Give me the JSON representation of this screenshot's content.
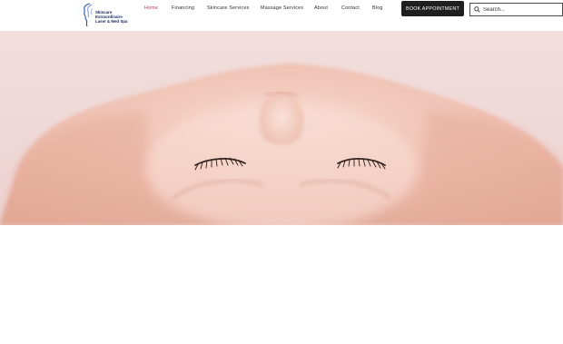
{
  "brand": {
    "line1": "Skincare",
    "line2": "Extraordinaire",
    "line3": "Laser & Med Spa",
    "color": "#1d2c63"
  },
  "nav": {
    "items": [
      {
        "label": "Home",
        "active": true
      },
      {
        "label": "Financing",
        "active": false
      },
      {
        "label": "Skincare Services",
        "active": false
      },
      {
        "label": "Massage Services",
        "active": false
      },
      {
        "label": "About",
        "active": false
      },
      {
        "label": "Contact",
        "active": false
      },
      {
        "label": "Blog",
        "active": false
      }
    ],
    "active_color": "#c2316b"
  },
  "cta": {
    "book_label": "BOOK APPOINTMENT"
  },
  "search": {
    "placeholder": "Search..."
  },
  "hero": {
    "image": "face-closed-eyes-photo"
  }
}
